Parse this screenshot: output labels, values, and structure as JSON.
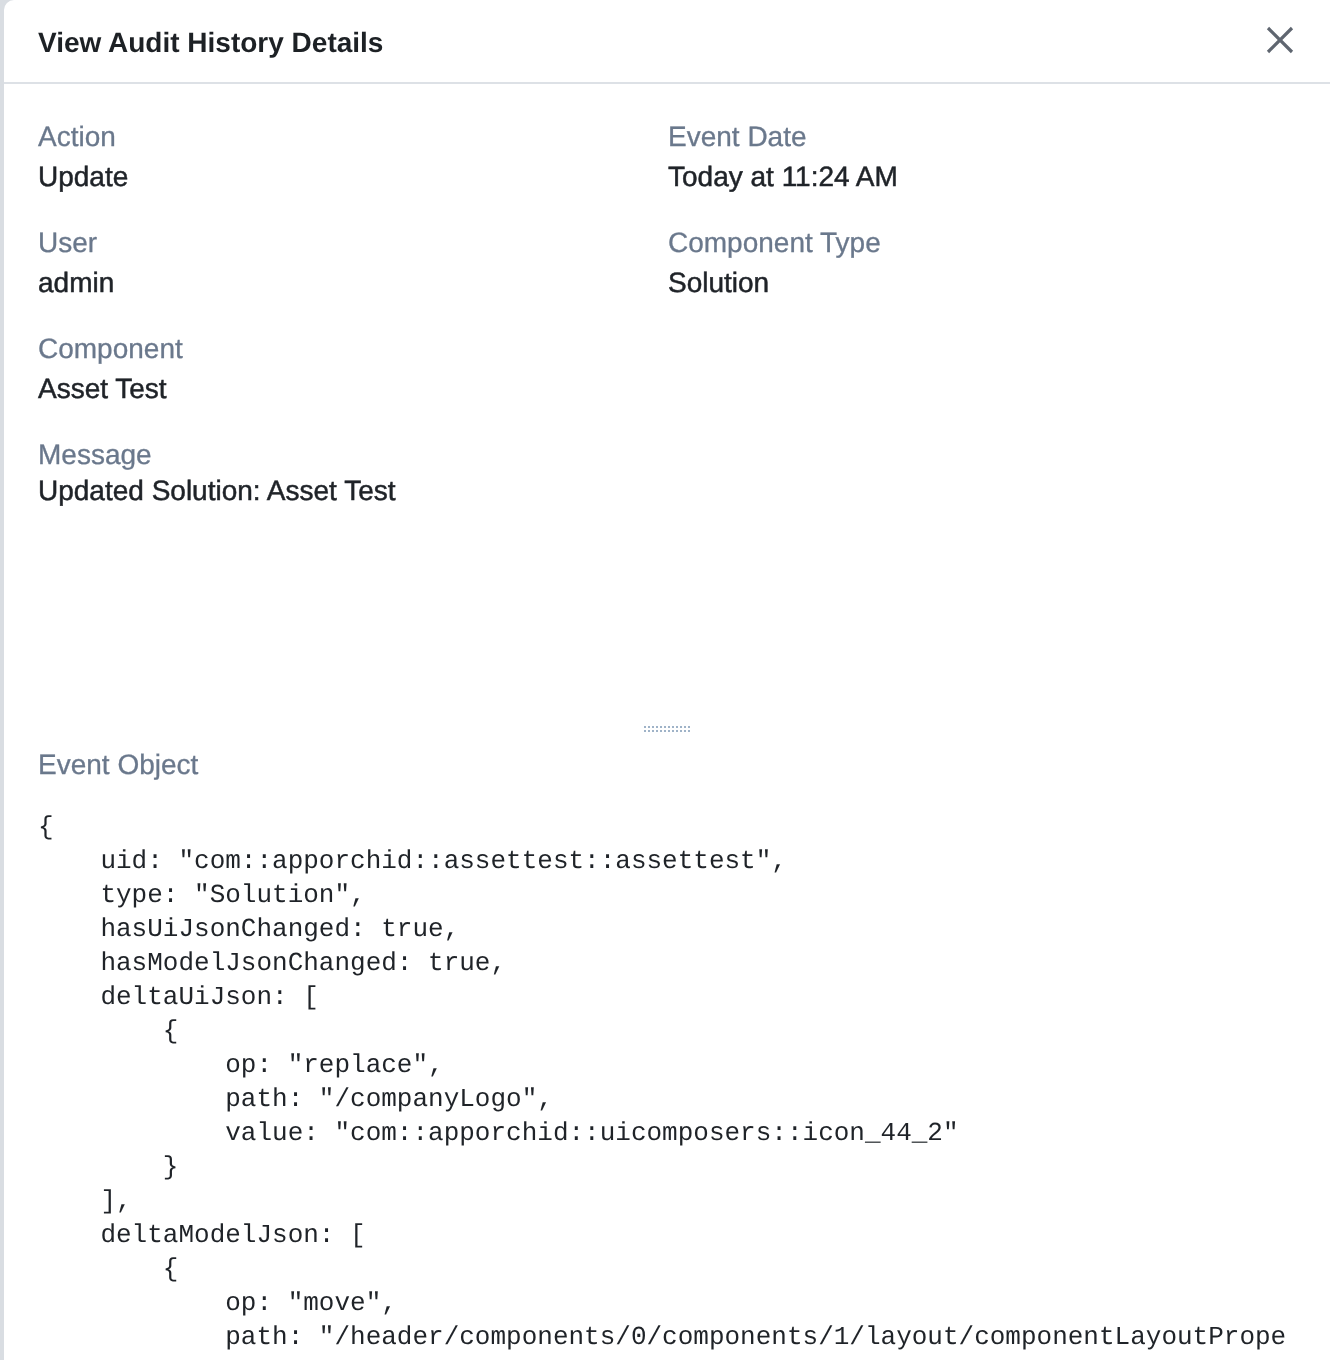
{
  "dialog": {
    "title": "View Audit History Details"
  },
  "fields": [
    {
      "label": "Action",
      "value": "Update"
    },
    {
      "label": "Event Date",
      "value": "Today at 11:24 AM"
    },
    {
      "label": "User",
      "value": "admin"
    },
    {
      "label": "Component Type",
      "value": "Solution"
    },
    {
      "label": "Component",
      "value": "Asset Test"
    }
  ],
  "message": {
    "label": "Message",
    "value": "Updated Solution: Asset Test"
  },
  "event_object": {
    "label": "Event Object",
    "lines": [
      "{",
      "    uid: \"com::apporchid::assettest::assettest\",",
      "    type: \"Solution\",",
      "    hasUiJsonChanged: true,",
      "    hasModelJsonChanged: true,",
      "    deltaUiJson: [",
      "        {",
      "            op: \"replace\",",
      "            path: \"/companyLogo\",",
      "            value: \"com::apporchid::uicomposers::icon_44_2\"",
      "        }",
      "    ],",
      "    deltaModelJson: [",
      "        {",
      "            op: \"move\",",
      "            path: \"/header/components/0/components/1/layout/componentLayoutPrope"
    ]
  }
}
